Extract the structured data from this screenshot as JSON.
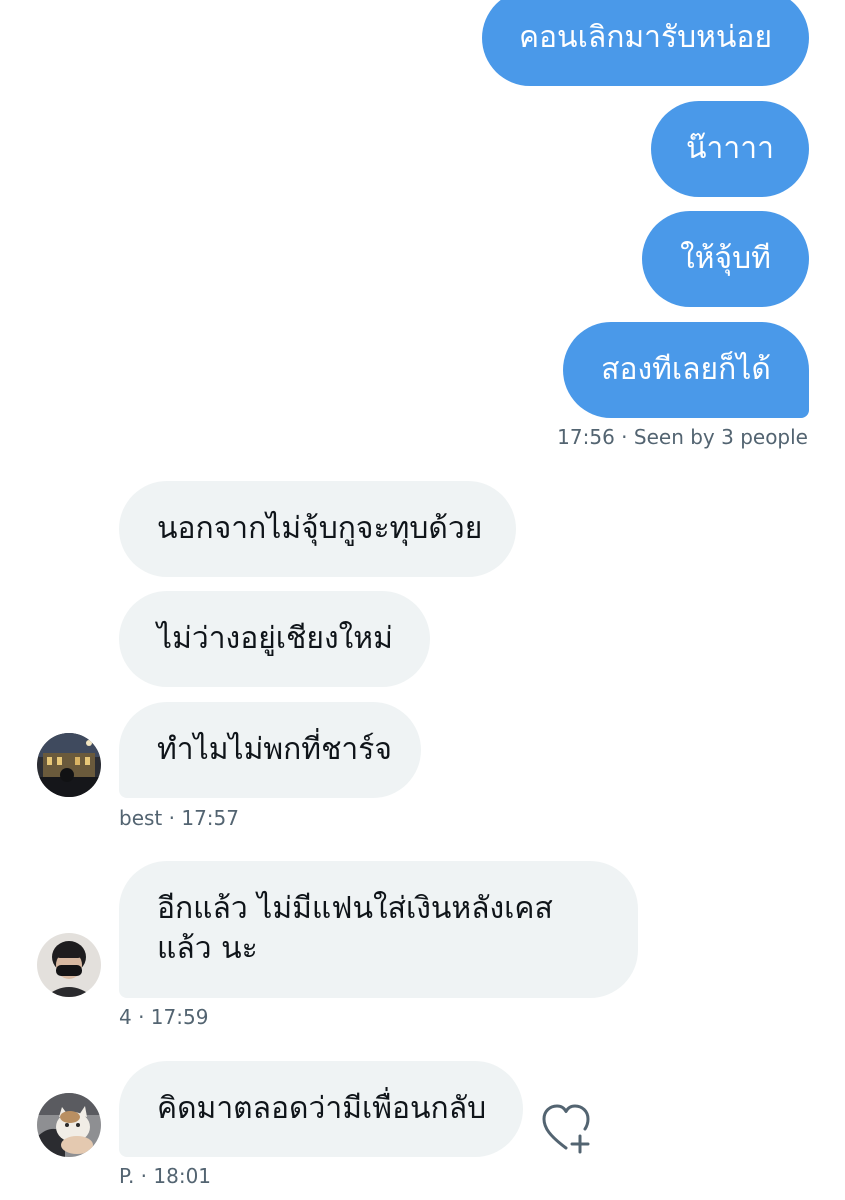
{
  "outgoing": {
    "messages": [
      "คอนเลิกมารับหน่อย",
      "น๊าาาา",
      "ให้จุ้บที",
      "สองทีเลยก็ได้"
    ],
    "time": "17:56",
    "seen": "· Seen by 3 people"
  },
  "groups": [
    {
      "messages": [
        "นอกจากไม่จุ้บกูจะทุบด้วย",
        "ไม่ว่างอยู่เชียงใหม่",
        "ทำไมไม่พกที่ชาร์จ"
      ],
      "sender": "best",
      "time": "· 17:57"
    },
    {
      "messages": [
        "อีกแล้ว ไม่มีแฟนใส่เงินหลังเคสแล้ว นะ"
      ],
      "sender": "4",
      "time": "· 17:59"
    },
    {
      "messages": [
        "คิดมาตลอดว่ามีเพื่อนกลับ"
      ],
      "sender": "P.",
      "time": "· 18:01"
    }
  ],
  "icons": {
    "react": "heart-plus-icon"
  },
  "colors": {
    "outgoing_bubble": "#4a99e9",
    "incoming_bubble": "#eff3f4",
    "meta_text": "#536471"
  }
}
